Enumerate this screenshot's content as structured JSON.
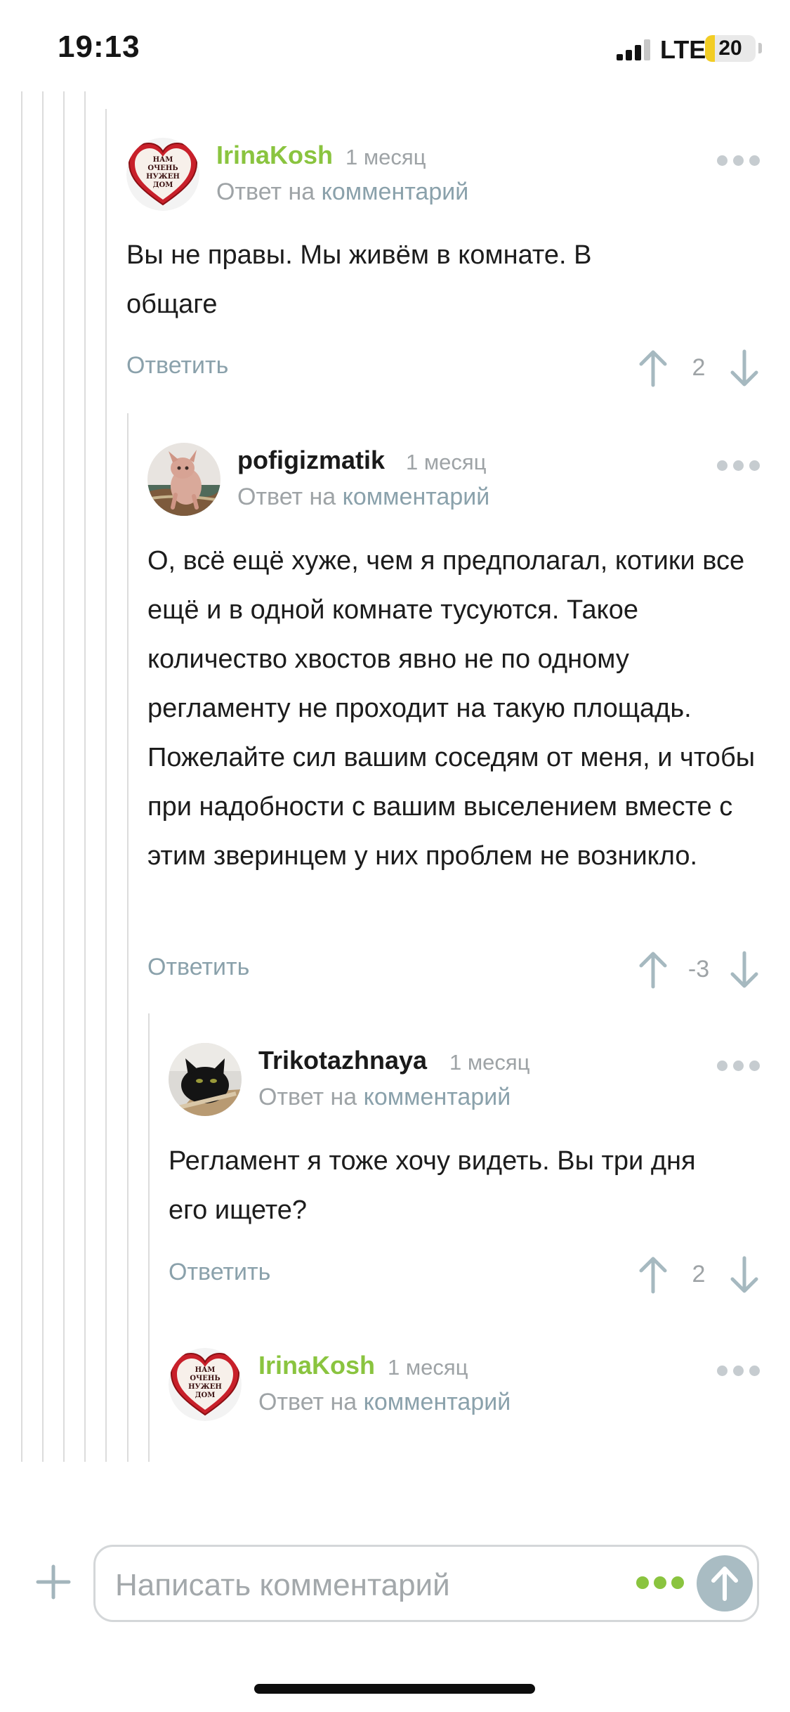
{
  "status_bar": {
    "time": "19:13",
    "network": "LTE",
    "battery": "20",
    "battery_level": 0.2
  },
  "comments": [
    {
      "author": "IrinaKosh",
      "time": "1 месяц",
      "reply_prefix": "Ответ на",
      "reply_link": "комментарий",
      "text": "Вы не правы. Мы живём в комнате. В общаге",
      "reply_label": "Ответить",
      "score": "2",
      "avatar": "heart-avatar",
      "avatar_text": "НАМ ОЧЕНЬ НУЖЕН ДОМ"
    },
    {
      "author": "pofigizmatik",
      "time": "1 месяц",
      "reply_prefix": "Ответ на",
      "reply_link": "комментарий",
      "text": "О, всё ещё хуже, чем я предполагал, котики все ещё и в одной комнате тусуются. Такое количество хвостов явно не по одному регламенту не проходит на такую площадь. Пожелайте сил вашим соседям от меня, и чтобы при надобности с вашим выселением вместе с этим зверинцем у них проблем не возникло.",
      "reply_label": "Ответить",
      "score": "-3",
      "avatar": "sphynx-cat-photo"
    },
    {
      "author": "Trikotazhnaya",
      "time": "1 месяц",
      "reply_prefix": "Ответ на",
      "reply_link": "комментарий",
      "text": "Регламент я тоже хочу видеть. Вы три дня его ищете?",
      "reply_label": "Ответить",
      "score": "2",
      "avatar": "black-cat-photo"
    },
    {
      "author": "IrinaKosh",
      "time": "1 месяц",
      "reply_prefix": "Ответ на",
      "reply_link": "комментарий",
      "avatar": "heart-avatar",
      "avatar_text": "НАМ ОЧЕНЬ НУЖЕН ДОМ"
    }
  ],
  "composer": {
    "placeholder": "Написать комментарий"
  },
  "colors": {
    "author_green": "#8ac43f",
    "link_gray_blue": "#8aa1ab",
    "muted": "#9ea3a6"
  }
}
